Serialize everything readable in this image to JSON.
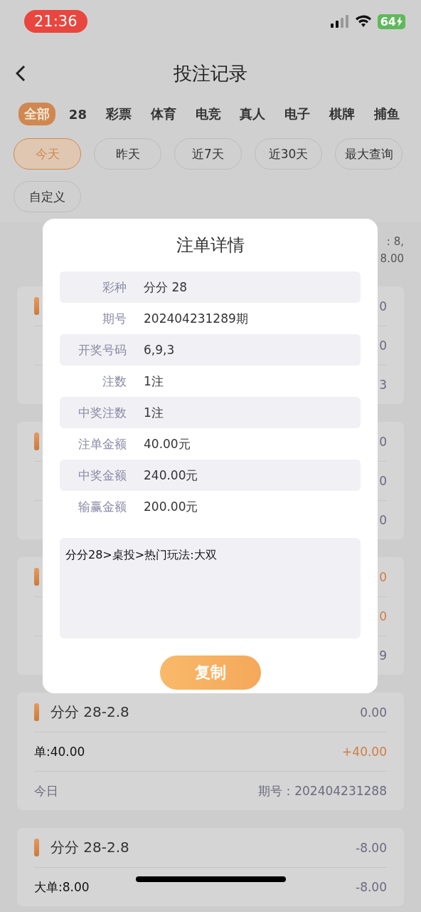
{
  "status_bar": {
    "time": "21:36",
    "battery": "64"
  },
  "header": {
    "title": "投注记录"
  },
  "categories": [
    {
      "label": "全部",
      "selected": true
    },
    {
      "label": "28",
      "selected": false
    },
    {
      "label": "彩票",
      "selected": false
    },
    {
      "label": "体育",
      "selected": false
    },
    {
      "label": "电竞",
      "selected": false
    },
    {
      "label": "真人",
      "selected": false
    },
    {
      "label": "电子",
      "selected": false
    },
    {
      "label": "棋牌",
      "selected": false
    },
    {
      "label": "捕鱼",
      "selected": false
    }
  ],
  "date_filters": [
    {
      "label": "今天",
      "selected": true
    },
    {
      "label": "昨天",
      "selected": false
    },
    {
      "label": "近7天",
      "selected": false
    },
    {
      "label": "近30天",
      "selected": false
    },
    {
      "label": "最大查询",
      "selected": false
    },
    {
      "label": "自定义",
      "selected": false
    }
  ],
  "summary": {
    "line_1": ": 8,",
    "line_2": "8.00"
  },
  "records": [
    {
      "amount": "0",
      "amount_win": false,
      "payout": "0",
      "payout_win": false,
      "issue": "3"
    },
    {
      "amount": "0",
      "amount_win": false,
      "payout": "0",
      "payout_win": false,
      "issue": "0"
    },
    {
      "amount": "0",
      "amount_win": true,
      "payout": "0",
      "payout_win": true,
      "issue": "9"
    },
    {
      "title": "分分 28-2.8",
      "amount": "0.00",
      "amount_win": false,
      "bet": "单:40.00",
      "payout": "+40.00",
      "payout_win": true,
      "date": "今日",
      "issue": "期号：202404231288"
    },
    {
      "title": "分分 28-2.8",
      "amount": "-8.00",
      "amount_win": false,
      "bet": "大单:8.00",
      "payout": "-8.00",
      "payout_win": false
    }
  ],
  "modal": {
    "title": "注单详情",
    "rows": [
      {
        "label": "彩种",
        "value": "分分 28"
      },
      {
        "label": "期号",
        "value": "202404231289期"
      },
      {
        "label": "开奖号码",
        "value": "6,9,3"
      },
      {
        "label": "注数",
        "value": "1注"
      },
      {
        "label": "中奖注数",
        "value": "1注"
      },
      {
        "label": "注单金额",
        "value": "40.00元"
      },
      {
        "label": "中奖金额",
        "value": "240.00元"
      },
      {
        "label": "输赢金额",
        "value": "200.00元"
      }
    ],
    "note": "分分28>桌投>热门玩法:大双",
    "copy_button": "复制"
  }
}
